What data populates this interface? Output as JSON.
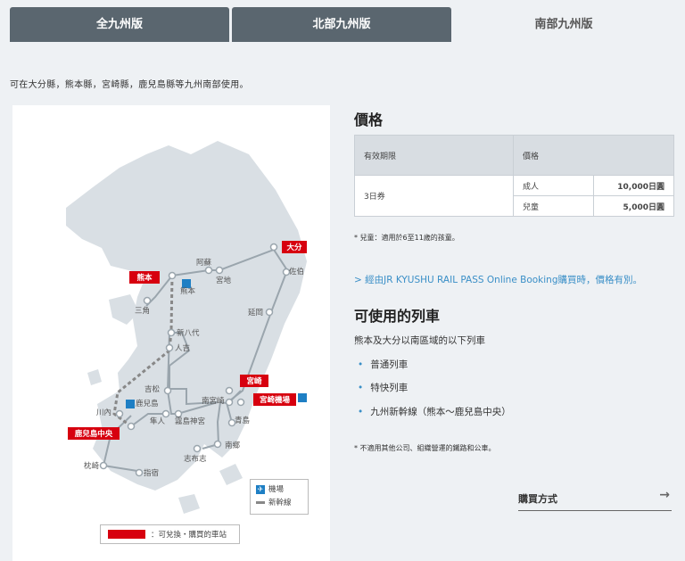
{
  "tabs": [
    {
      "label": "全九州版"
    },
    {
      "label": "北部九州版"
    },
    {
      "label": "南部九州版"
    }
  ],
  "intro": "可在大分縣，熊本縣，宮崎縣，鹿兒島縣等九州南部使用。",
  "map": {
    "red_stations": [
      "大分",
      "熊本",
      "宮崎",
      "宮崎機場",
      "鹿兒島中央"
    ],
    "stations": [
      "阿蘇",
      "宮地",
      "佐伯",
      "熊本",
      "三角",
      "延岡",
      "新八代",
      "人吉",
      "吉松",
      "南宮崎",
      "鹿兒島",
      "川內",
      "隼人",
      "霧島神宮",
      "青島",
      "南鄉",
      "志布志",
      "枕崎",
      "指宿"
    ],
    "legend": {
      "airport": "機場",
      "shinkansen": "新幹線"
    },
    "red_key": "：可兌換・購買的車站",
    "colors": {
      "land": "#d9dfe4",
      "line": "#9aa5ad",
      "red": "#d7000f",
      "airport": "#1e7fc4"
    }
  },
  "price": {
    "heading": "價格",
    "col_period": "有效期限",
    "col_price": "價格",
    "period": "3日券",
    "adult_label": "成人",
    "adult_price": "10,000日圓",
    "child_label": "兒童",
    "child_price": "5,000日圓",
    "note": "* 兒童：適用於6至11歲的孩童。"
  },
  "online_link": "> 經由JR KYUSHU RAIL PASS Online Booking購買時，價格有別。",
  "trains": {
    "heading": "可使用的列車",
    "desc": "熊本及大分以南區域的以下列車",
    "items": [
      "普通列車",
      "特快列車",
      "九州新幹線（熊本～鹿兒島中央）"
    ],
    "note": "* 不適用其他公司、組織營運的鐵路和公車。"
  },
  "buy": {
    "label": "購買方式",
    "arrow": "→"
  }
}
